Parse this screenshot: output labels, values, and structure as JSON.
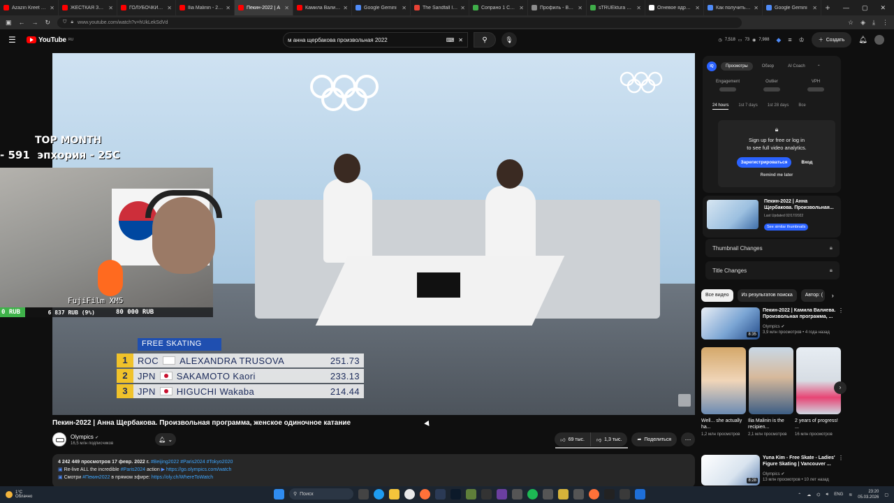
{
  "browser": {
    "tabs": [
      {
        "label": "Azazin Kreet - YouT",
        "color": "#ff0000"
      },
      {
        "label": "ЖЕСТКАЯ ЗАРУБА",
        "color": "#ff0000"
      },
      {
        "label": "ГОЛУБОЧКИН УНИ",
        "color": "#ff0000"
      },
      {
        "label": "Ilia Malinin - 2026",
        "color": "#ff0000"
      },
      {
        "label": "Пекин-2022 | А",
        "color": "#ff0000",
        "active": true
      },
      {
        "label": "Камила Валиева. К",
        "color": "#ff0000"
      },
      {
        "label": "Google Gemini",
        "color": "#4f8bf7"
      },
      {
        "label": "The Sandfall Intera",
        "color": "#e94235"
      },
      {
        "label": "Сопрано 1 Сезон С",
        "color": "#3fae49"
      },
      {
        "label": "Профиль - Battles",
        "color": "#8c8c8c"
      },
      {
        "label": "sTRUEktura Stream",
        "color": "#3fae49"
      },
      {
        "label": "Огневое ядро час",
        "color": "#ffffff"
      },
      {
        "label": "Как получить и ис",
        "color": "#4f8bf7"
      },
      {
        "label": "Google Gemini",
        "color": "#4f8bf7"
      }
    ],
    "url": "www.youtube.com/watch?v=hUkLekSdVd"
  },
  "header": {
    "logo": "YouTube",
    "region": "RU",
    "search_query": "м анна щербакова произвольная 2022",
    "stats": [
      "7,518",
      "73",
      "7,988"
    ],
    "create_label": "Создать"
  },
  "video": {
    "stream_overlay": {
      "top_month": "TOP MONTH",
      "donation_line": "- 591  эпхория - 25С",
      "camera": "FujiFilm XM5",
      "rub_left": "0 RUB",
      "rub_mid": "6 837 RUB (9%)",
      "rub_right": "80 000 RUB"
    },
    "scoreboard": {
      "title": "FREE SKATING",
      "rows": [
        {
          "rank": "1",
          "noc": "ROC",
          "name": "ALEXANDRA TRUSOVA",
          "score": "251.73"
        },
        {
          "rank": "2",
          "noc": "JPN",
          "name": "SAKAMOTO Kaori",
          "score": "233.13"
        },
        {
          "rank": "3",
          "noc": "JPN",
          "name": "HIGUCHI Wakaba",
          "score": "214.44"
        }
      ]
    },
    "title": "Пекин-2022 | Анна Щербакова. Произвольная программа, женское одиночное катание",
    "channel": {
      "name": "Olympics",
      "subs": "16,5 млн подписчиков"
    },
    "likes": "69 тыс.",
    "dislikes": "1,3 тыс.",
    "share_label": "Поделиться",
    "description": {
      "meta": "4 242 449 просмотров  17 февр. 2022 г.",
      "tags": "#Beijing2022 #Paris2024 #Tokyo2020",
      "line2_prefix": "Re-live ALL the incredible",
      "line2_tag": "#Paris2024",
      "line2_mid": "action",
      "line2_link": "https://go.olympics.com/watch",
      "line3_prefix": "Смотри",
      "line3_tag": "#Пекин2022",
      "line3_mid": "в прямом эфире:",
      "line3_link": "https://oly.ch/WhereToWatch"
    }
  },
  "sidebar": {
    "analytics": {
      "badge": "IQ",
      "tabs": [
        "Просмотры",
        "Обзор",
        "AI Coach"
      ],
      "metrics": [
        "Engagement",
        "Outlier",
        "VPH"
      ],
      "ranges": [
        "24 hours",
        "1st 7 days",
        "1st 28 days",
        "Все"
      ],
      "lock_msg_1": "Sign up for free or log in",
      "lock_msg_2": "to see full video analytics.",
      "register": "Зарегистрироваться",
      "login": "Вход",
      "remind": "Remind me later"
    },
    "thumb_card": {
      "title": "Пекин-2022 | Анна Щербакова. Произвольная...",
      "updated": "Last Updated 02/17/2022",
      "similar": "See similar thumbnails"
    },
    "locked_rows": [
      "Thumbnail Changes",
      "Title Changes"
    ],
    "chips": [
      "Все видео",
      "Из результатов поиска",
      "Автор: ("
    ],
    "recs": [
      {
        "title": "Пекин-2022 | Камила Валиева. Произвольная программа, ...",
        "channel": "Olympics",
        "views": "3,9 млн просмотров • 4 года назад",
        "duration": "8:35"
      },
      {
        "title": "Yuna Kim - Free Skate - Ladies' Figure Skating | Vancouver ...",
        "channel": "Olympics",
        "views": "13 млн просмотров • 10 лет назад",
        "duration": "8:28"
      }
    ],
    "shorts": [
      {
        "title": "Well... she actually ha...",
        "views": "1,2 млн просмотров"
      },
      {
        "title": "Ilia Malinin is the recipien...",
        "views": "2,1 млн просмотров"
      },
      {
        "title": "2 years of progress! ...",
        "views": "16 млн просмотров"
      }
    ]
  },
  "taskbar": {
    "temp": "1°C",
    "weather": "Облачно",
    "search": "Поиск",
    "lang": "ENG",
    "time": "23:20",
    "date": "05.03.2026"
  }
}
